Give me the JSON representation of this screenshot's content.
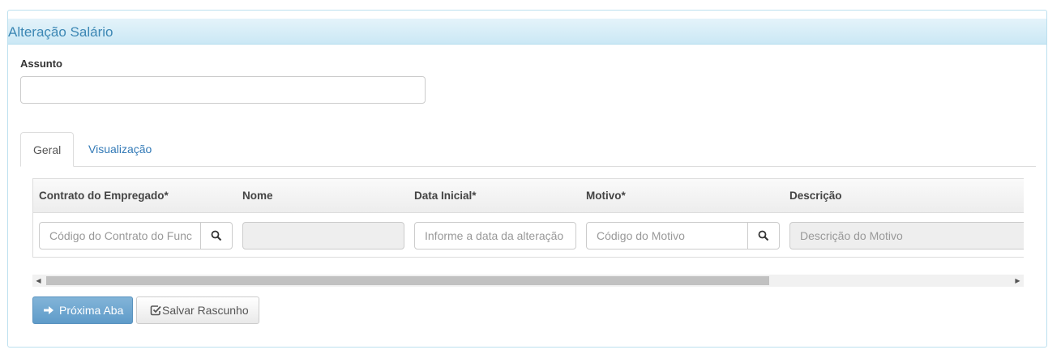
{
  "panel": {
    "title": "Alteração Salário"
  },
  "form": {
    "assunto_label": "Assunto",
    "assunto_value": ""
  },
  "tabs": [
    {
      "label": "Geral",
      "active": true
    },
    {
      "label": "Visualização",
      "active": false
    }
  ],
  "table": {
    "headers": [
      "Contrato do Empregado*",
      "Nome",
      "Data Inicial*",
      "Motivo*",
      "Descrição"
    ],
    "row": {
      "contrato_placeholder": "Código do Contrato do Func",
      "nome_value": "",
      "data_placeholder": "Informe a data da alteração",
      "motivo_placeholder": "Código do Motivo",
      "descricao_placeholder": "Descrição do Motivo"
    }
  },
  "buttons": {
    "next_label": "Próxima Aba",
    "draft_label": "Salvar Rascunho"
  },
  "icons": {
    "search": "search-icon",
    "next": "arrow-right-icon",
    "draft": "edit-check-icon"
  },
  "colors": {
    "heading_bg": "#cbe8f5",
    "title": "#3c87b4",
    "link": "#337ab7",
    "primary_button": "#5f9bc9"
  }
}
